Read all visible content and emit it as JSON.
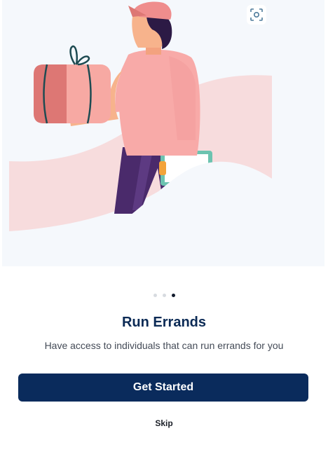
{
  "onboarding": {
    "title": "Run Errands",
    "subtitle": "Have access to individuals that can run errands for you",
    "primary_button": "Get Started",
    "skip_label": "Skip",
    "page_indicator": {
      "total": 3,
      "current": 3
    }
  },
  "icons": {
    "scan": "scan-focus-icon"
  },
  "colors": {
    "primary": "#0a2b5c",
    "title": "#0b2a55",
    "hero_background": "#f5f8fc",
    "accent_pink": "#f7a9a3"
  }
}
